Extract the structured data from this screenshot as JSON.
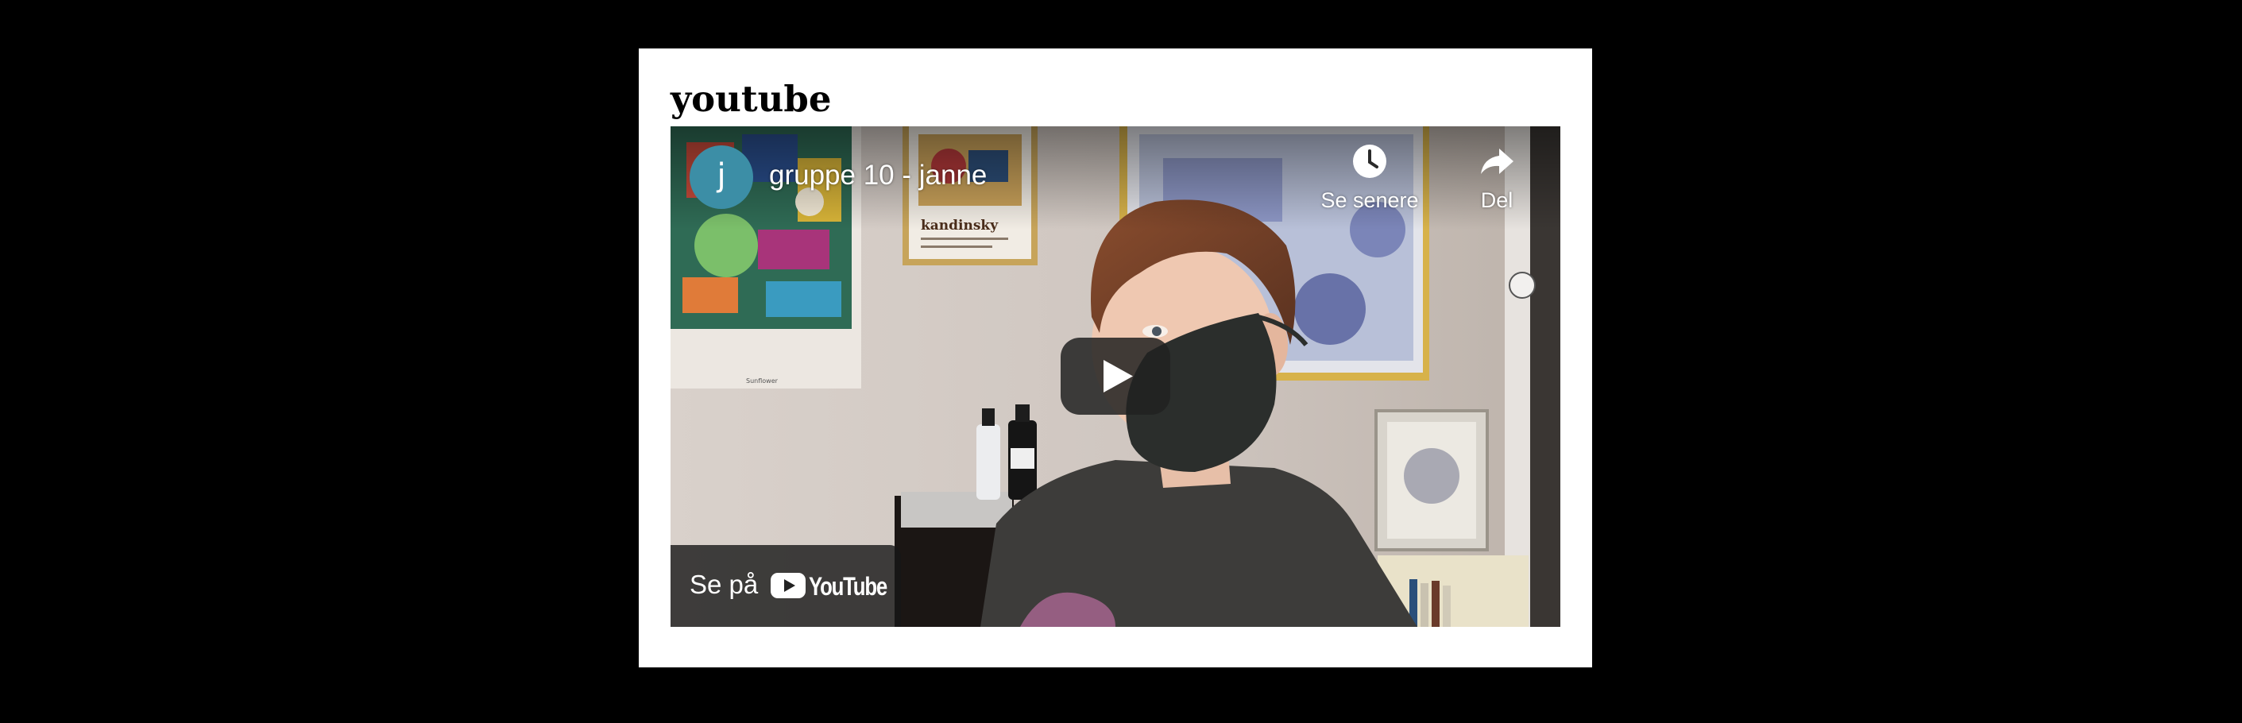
{
  "page": {
    "title": "youtube"
  },
  "player": {
    "channel_initial": "j",
    "video_title": "gruppe 10 - janne",
    "watch_later_label": "Se senere",
    "share_label": "Del",
    "watch_on_label": "Se på",
    "youtube_wordmark": "YouTube",
    "play_icon": "play-icon",
    "watch_later_icon": "clock-icon",
    "share_icon": "share-arrow-icon",
    "colors": {
      "avatar_bg": "#3c8ea6",
      "play_button_bg": "#212121",
      "page_bg": "#ffffff",
      "frame_bg": "#000000"
    }
  }
}
